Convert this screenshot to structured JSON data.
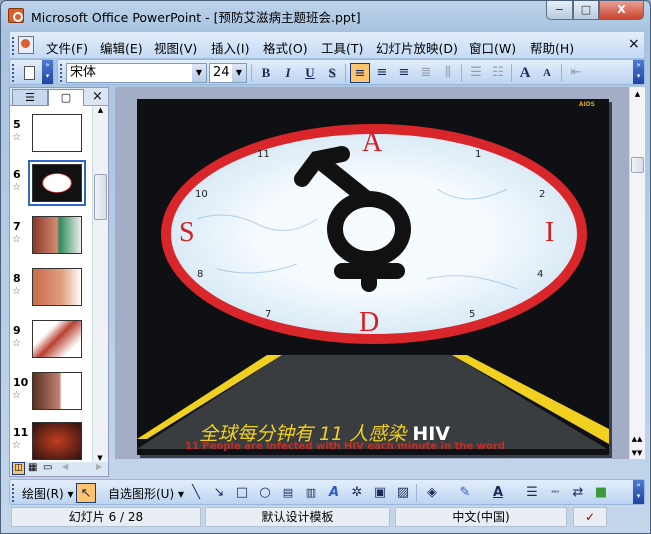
{
  "window": {
    "title": "Microsoft Office PowerPoint - [预防艾滋病主题班会.ppt]",
    "minimize": "−",
    "maximize": "□",
    "close": "X"
  },
  "menu": {
    "items": [
      "文件(F)",
      "编辑(E)",
      "视图(V)",
      "插入(I)",
      "格式(O)",
      "工具(T)",
      "幻灯片放映(D)",
      "窗口(W)",
      "帮助(H)"
    ],
    "close": "×"
  },
  "toolbar": {
    "font": "宋体",
    "size": "24",
    "bold": "B",
    "italic": "I",
    "underline": "U",
    "shadow": "S",
    "increase_font": "A",
    "decrease_font": "A"
  },
  "outline_pane": {
    "close": "×",
    "slides": [
      {
        "num": "5"
      },
      {
        "num": "6",
        "selected": true
      },
      {
        "num": "7"
      },
      {
        "num": "8"
      },
      {
        "num": "9"
      },
      {
        "num": "10"
      },
      {
        "num": "11"
      }
    ]
  },
  "slide": {
    "corner_label": "AIDS",
    "letters": [
      "A",
      "S",
      "I",
      "D"
    ],
    "clock_numbers": [
      "11",
      "1",
      "2",
      "10",
      "8",
      "4",
      "7",
      "5"
    ],
    "headline": "全球每分钟有 11 人感染",
    "headline_hiv": "HIV",
    "subtitle": "11 People are infected with HIV each minute in the word"
  },
  "drawing_toolbar": {
    "draw": "绘图(R)",
    "autoshapes": "自选图形(U)"
  },
  "status": {
    "slide": "幻灯片 6 / 28",
    "template": "默认设计模板",
    "language": "中文(中国)"
  }
}
